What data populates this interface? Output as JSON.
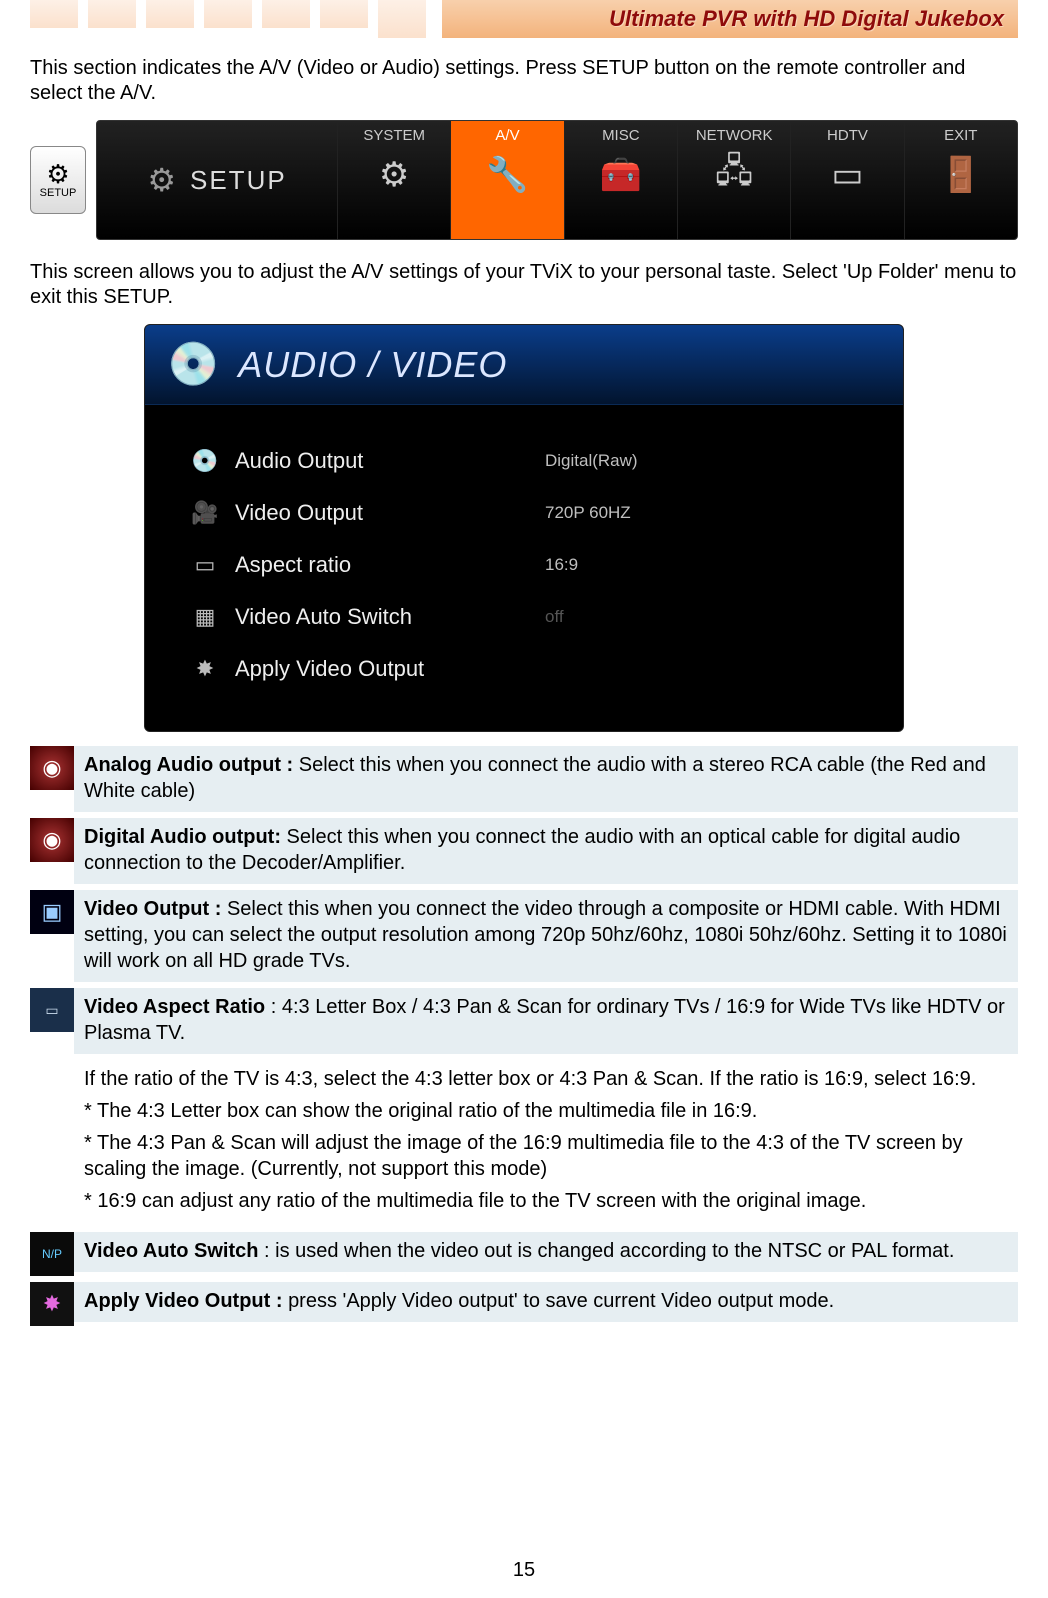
{
  "header": {
    "title": "Ultimate PVR with HD Digital Jukebox"
  },
  "intro": "This section indicates the A/V (Video or Audio) settings. Press SETUP button on the remote controller and select the A/V.",
  "setup_button": {
    "label": "SETUP"
  },
  "setup_menu": {
    "label": "SETUP",
    "items": [
      {
        "label": "SYSTEM",
        "icon": "⚙"
      },
      {
        "label": "A/V",
        "icon": "🔧"
      },
      {
        "label": "MISC",
        "icon": "🧰"
      },
      {
        "label": "NETWORK",
        "icon": "🖧"
      },
      {
        "label": "HDTV",
        "icon": "▭"
      },
      {
        "label": "EXIT",
        "icon": "🚪"
      }
    ],
    "active_index": 1
  },
  "intro2": "This screen allows you to adjust the A/V settings of your TViX to your personal taste. Select 'Up Folder' menu to exit this SETUP.",
  "av_panel": {
    "title": "AUDIO / VIDEO",
    "rows": [
      {
        "icon": "💿",
        "label": "Audio Output",
        "value": "Digital(Raw)"
      },
      {
        "icon": "🎥",
        "label": "Video Output",
        "value": "720P 60HZ"
      },
      {
        "icon": "▭",
        "label": "Aspect ratio",
        "value": "16:9"
      },
      {
        "icon": "▦",
        "label": "Video Auto Switch",
        "value": "off"
      },
      {
        "icon": "✸",
        "label": "Apply Video Output",
        "value": ""
      }
    ]
  },
  "info": [
    {
      "thumb_class": "red-disc",
      "title": "Analog Audio output : ",
      "body": "Select this when you connect the audio with a stereo RCA cable (the Red and White cable)"
    },
    {
      "thumb_class": "red-disc",
      "title": "Digital Audio output: ",
      "body": "Select this when you connect the audio with an optical cable for digital audio connection to the Decoder/Amplifier."
    },
    {
      "thumb_class": "mon",
      "title": "Video Output : ",
      "body": "Select this when you connect the video through a composite or HDMI cable. With HDMI setting, you can select the output resolution among 720p 50hz/60hz, 1080i 50hz/60hz. Setting it to 1080i will work on all HD grade TVs."
    },
    {
      "thumb_class": "ratio",
      "title": "Video Aspect Ratio ",
      "body": ": 4:3 Letter Box / 4:3 Pan & Scan for ordinary TVs / 16:9 for Wide TVs like HDTV or Plasma TV.",
      "extra": [
        "If the ratio of the TV is 4:3, select the 4:3 letter box or 4:3 Pan & Scan. If the ratio is 16:9, select 16:9.",
        "* The 4:3 Letter box can show the original ratio of the multimedia file in 16:9.",
        "* The 4:3 Pan & Scan will adjust the image of the 16:9 multimedia file to the 4:3 of the TV screen by scaling the image. (Currently, not support this mode)",
        "* 16:9 can adjust any ratio of the multimedia file to the TV screen with the original image."
      ]
    },
    {
      "thumb_class": "np",
      "thumb_text": "N/P",
      "title": "Video Auto Switch ",
      "body": ": is used when the video out is changed according to the NTSC or PAL format."
    },
    {
      "thumb_class": "star",
      "thumb_text": "✸",
      "title": "Apply Video Output : ",
      "body": "press 'Apply Video output' to save current Video output mode."
    }
  ],
  "page_number": "15"
}
